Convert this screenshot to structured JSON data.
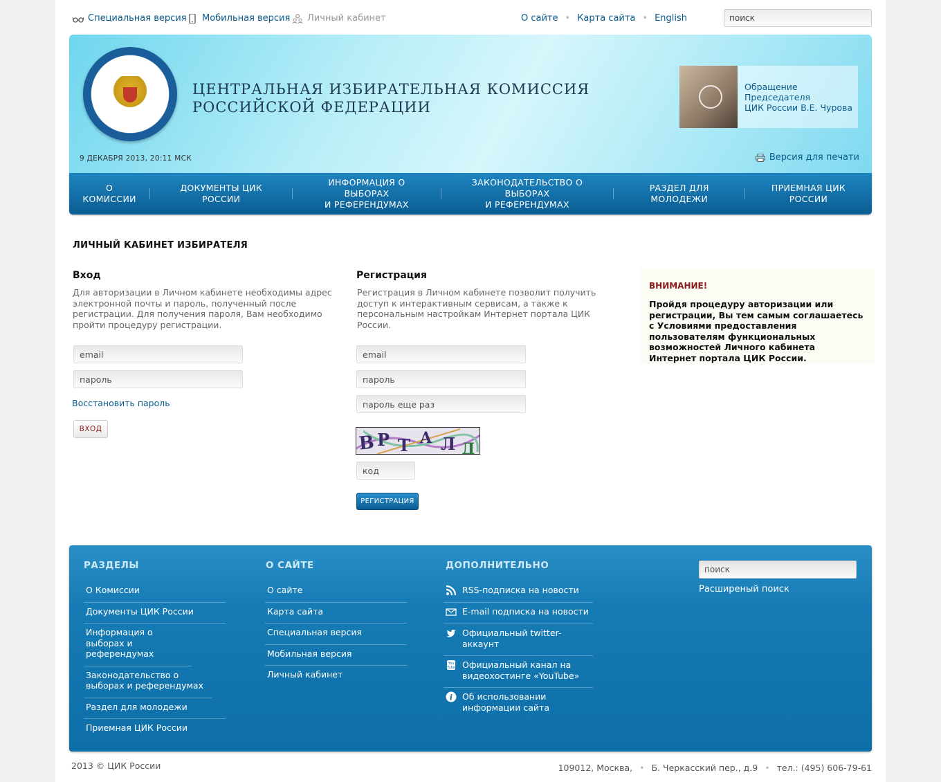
{
  "topbar": {
    "special": "Специальная версия",
    "mobile": "Мобильная версия",
    "cabinet": "Личный кабинет",
    "about": "О сайте",
    "sitemap": "Карта сайта",
    "english": "English",
    "search_placeholder": "поиск"
  },
  "header": {
    "title_line1": "ЦЕНТРАЛЬНАЯ ИЗБИРАТЕЛЬНАЯ КОМИССИЯ",
    "title_line2": "РОССИЙСКОЙ ФЕДЕРАЦИИ",
    "chair_line1": "Обращение Председателя",
    "chair_line2": "ЦИК России В.Е. Чурова",
    "date": "9 ДЕКАБРЯ 2013, 20:11 МСК",
    "print": "Версия для печати"
  },
  "nav": {
    "item1": "О комиссии",
    "item2": "Документы  ЦИК России",
    "item3a": "Информация о выборах",
    "item3b": "и референдумах",
    "item4a": "Законодательство о выборах",
    "item4b": "и референдумах",
    "item5": "Раздел для молодежи",
    "item6": "Приемная ЦИК России"
  },
  "content": {
    "page_title": "ЛИЧНЫЙ КАБИНЕТ ИЗБИРАТЕЛЯ",
    "login": {
      "heading": "Вход",
      "text": "Для авторизации в Личном кабинете необходимы адрес электронной почты и пароль, полученный после регистрации. Для получения пароля, Вам необходимо пройти процедуру регистрации.",
      "email": "email",
      "password": "пароль",
      "restore": "Восстановить пароль",
      "button": "ВХОД"
    },
    "register": {
      "heading": "Регистрация",
      "text": "Регистрация в Личном кабинете позволит получить доступ к интерактивным сервисам, а также к персональным настройкам Интернет портала ЦИК России.",
      "email": "email",
      "password": "пароль",
      "password2": "пароль еще раз",
      "code": "код",
      "button": "РЕГИСТРАЦИЯ"
    },
    "notice": {
      "title": "ВНИМАНИЕ!",
      "body": "Пройдя процедуру авторизации или регистрации, Вы тем самым соглашаетесь с Условиями предоставления пользователям функциональных возможностей Личного кабинета Интернет портала ЦИК России."
    }
  },
  "footer": {
    "sections_title": "РАЗДЕЛЫ",
    "sections": [
      "О Комиссии",
      "Документы ЦИК России",
      "Информация о выборах и референдумах",
      "Законодательство о выборах и референдумах",
      "Раздел для молодежи",
      "Приемная ЦИК России"
    ],
    "site_title": "О САЙТЕ",
    "site": [
      "О сайте",
      "Карта сайта",
      "Специальная версия",
      "Мобильная версия",
      "Личный кабинет"
    ],
    "extra_title": "ДОПОЛНИТЕЛЬНО",
    "extra": [
      "RSS-подписка на новости",
      "E-mail подписка на новости",
      "Официальный twitter-аккаунт",
      "Официальный канал на видеохостинге «YouTube»",
      "Об использовании информации сайта"
    ],
    "search_placeholder": "поиск",
    "advanced_search": "Расширеный поиск"
  },
  "bottom": {
    "copyright": "2013 © ЦИК России",
    "address": "109012, Москва,",
    "street": "Б. Черкасский пер., д.9",
    "phone": "тел.: (495) 606-79-61"
  },
  "colors": {
    "accent": "#0b5b8c",
    "nav": "#0a5d93",
    "alert": "#8b1a1a"
  }
}
